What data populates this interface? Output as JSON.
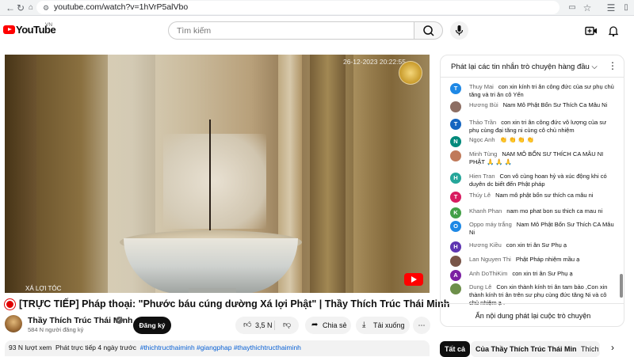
{
  "browser": {
    "url": "youtube.com/watch?v=1hVrP5alVbo",
    "icons": [
      "back-icon",
      "reload-icon",
      "home-icon",
      "site-info-icon",
      "cast-icon",
      "star-icon",
      "extensions-icon",
      "sidebar-icon"
    ]
  },
  "header": {
    "logo_text": "YouTube",
    "region": "VN",
    "search_placeholder": "Tìm kiếm"
  },
  "video": {
    "timestamp": "26-12-2023 20:22:55",
    "caption": "XÁ LỢI TÓC",
    "logo_text": "Thầy Thích Trúc Thái Minh"
  },
  "title": "[TRỰC TIẾP] Pháp thoại: \"Phước báu cúng dường Xá lợi Phật\" | Thầy Thích Trúc Thái Minh",
  "channel": {
    "name": "Thầy Thích Trúc Thái Minh",
    "subscribers": "584 N người đăng ký",
    "subscribe_label": "Đăng ký"
  },
  "actions": {
    "likes": "3,5 N",
    "share_label": "Chia sẻ",
    "download_label": "Tải xuống"
  },
  "description": {
    "views": "93 N lượt xem",
    "time": "Phát trực tiếp 4 ngày trước",
    "hashtags": "#thichtructhaiminh #giangphap #thaythichtructhaiminh"
  },
  "chat": {
    "header": "Phát lại các tin nhắn trò chuyện hàng đầu",
    "footer": "Ẩn nội dung phát lại cuộc trò chuyện",
    "messages": [
      {
        "initial": "T",
        "color": "#1e88e5",
        "author": "Thuy Mai",
        "text": "con xin kính tri ân công đức của sư phụ chủ tăng và tri ân cô Yến"
      },
      {
        "initial": "",
        "color": "#8d6e63",
        "author": "Hương Bùi",
        "text": "Nam Mô Phật Bổn Sư Thích Ca Mâu Ni"
      },
      {
        "initial": "T",
        "color": "#1565c0",
        "author": "Thảo Trần",
        "text": "con xin tri ân công đức vô lượng của sư phụ cùng đại tăng ni cùng cô chủ nhiệm"
      },
      {
        "initial": "N",
        "color": "#00897b",
        "author": "Ngọc Anh",
        "text": "👏 👏 👏 👏"
      },
      {
        "initial": "",
        "color": "#c07a5a",
        "author": "Minh Tùng",
        "text": "NAM MÔ BỔN SƯ THÍCH CA MÂU NI PHẬT 🙏 🙏 🙏"
      },
      {
        "initial": "H",
        "color": "#26a69a",
        "author": "Hien Tran",
        "text": "Con vô cùng hoan hỷ và xúc động khi có duyên dc biết đến Phật pháp"
      },
      {
        "initial": "T",
        "color": "#d81b60",
        "author": "Thúy Lê",
        "text": "Nam mô phật bổn sư thích ca mâu ni"
      },
      {
        "initial": "K",
        "color": "#43a047",
        "author": "Khanh Phan",
        "text": "nam mo phat bon su thich ca mau ni"
      },
      {
        "initial": "O",
        "color": "#1e88e5",
        "author": "Oppo máy trắng",
        "text": "Nam Mô Phật Bổn Sư Thích CA Mâu Ni"
      },
      {
        "initial": "H",
        "color": "#5e35b1",
        "author": "Hương Kiều",
        "text": "con xin tri ân Sư Phụ ạ"
      },
      {
        "initial": "",
        "color": "#795548",
        "author": "Lan Nguyen Thi",
        "text": "Phật Pháp nhiệm mầu ạ"
      },
      {
        "initial": "A",
        "color": "#7b1fa2",
        "author": "Anh DoThiKim",
        "text": "con xin tri ân Sư Phụ ạ"
      },
      {
        "initial": "",
        "color": "#6d8f4a",
        "author": "Dung Lê",
        "text": "Con xin thành kính tri ân tam bảo ,Con xin thành kính tri ân trên sư phụ cùng đức tăng Ni và cô chủ nhiệm ạ ."
      }
    ]
  },
  "chips": {
    "all": "Tất cả",
    "from_channel": "Của Thầy Thích Trúc Thái Minh",
    "partial": "Thích"
  }
}
